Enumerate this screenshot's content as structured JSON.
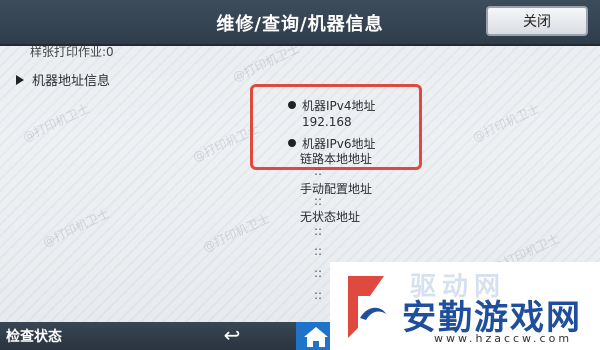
{
  "header": {
    "title": "维修/查询/机器信息",
    "close_label": "关闭"
  },
  "content": {
    "partial_line": "样张打印作业:0",
    "section_label": "机器地址信息",
    "ipv4_label": "机器IPv4地址",
    "ipv4_value": "192.168",
    "ipv6_label": "机器IPv6地址",
    "link_local_label": "链路本地地址",
    "link_local_value": "::",
    "manual_label": "手动配置地址",
    "manual_value": "::",
    "stateless_label": "无状态地址",
    "stateless_values": [
      "::",
      "::",
      "::",
      "::"
    ]
  },
  "watermarks": {
    "text": "@打印机卫士"
  },
  "footer": {
    "status_label": "检查状态",
    "back_icon": "back-arrow-icon",
    "home_icon": "home-icon"
  },
  "corner_logo": {
    "faded_text": "驱动网",
    "main_text": "安勤游戏网",
    "url": "www.hzaccw.com",
    "accent_color": "#1f4e9c",
    "mark_color": "#e0493f"
  },
  "colors": {
    "header_bg": "#34424f",
    "highlight": "#e0493f",
    "home_button": "#1f73c8"
  }
}
